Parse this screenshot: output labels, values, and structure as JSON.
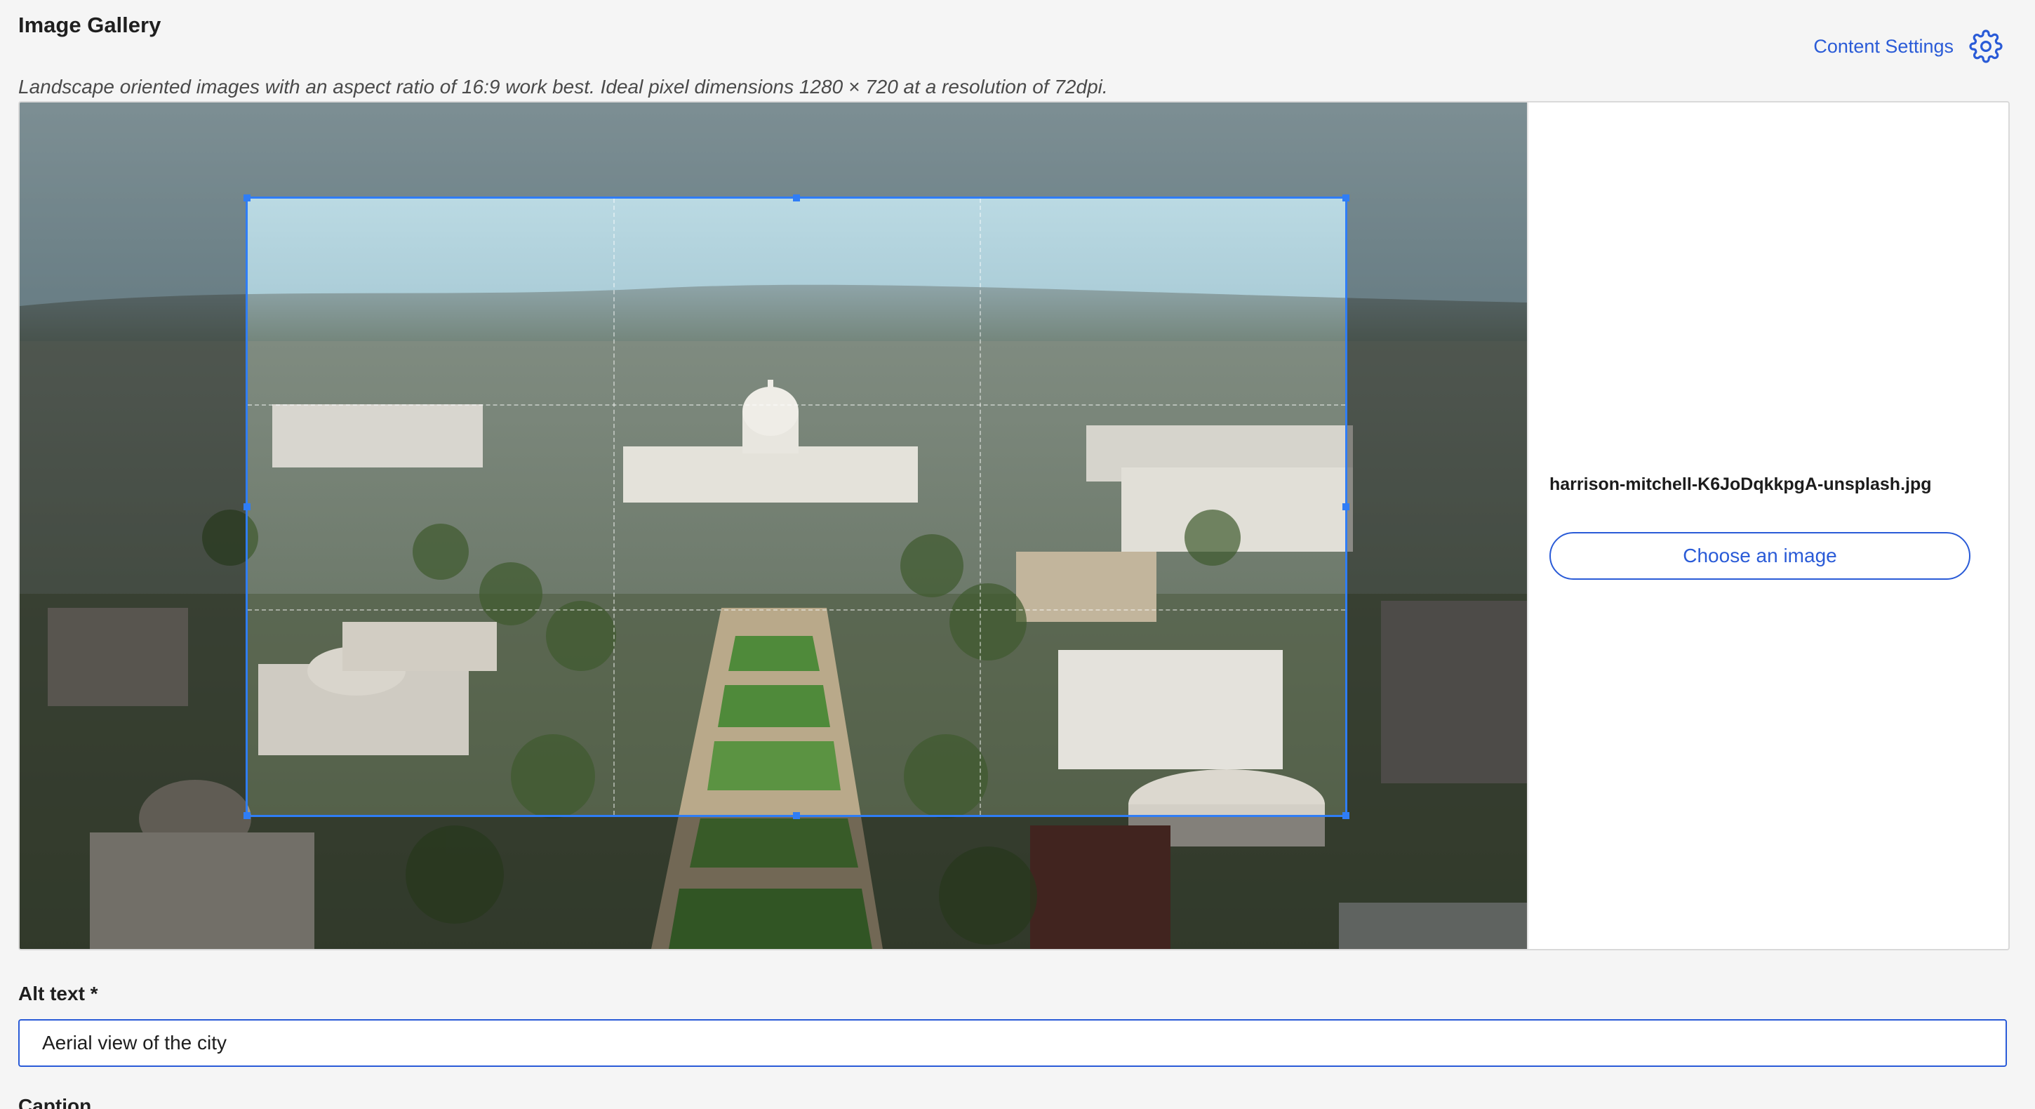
{
  "header": {
    "title": "Image Gallery",
    "settings_label": "Content Settings",
    "settings_icon": "gear-icon"
  },
  "hint": "Landscape oriented images with an aspect ratio of 16:9 work best. Ideal pixel dimensions 1280 × 720 at a resolution of 72dpi.",
  "editor": {
    "image_description_icon": "aerial-city-photo",
    "crop": {
      "aspect_ratio": "16:9"
    },
    "file_name": "harrison-mitchell-K6JoDqkkpgA-unsplash.jpg",
    "choose_button_label": "Choose an image"
  },
  "form": {
    "alt_label": "Alt text *",
    "alt_value": "Aerial view of the city",
    "caption_label": "Caption"
  },
  "colors": {
    "accent": "#2a5bd7",
    "crop_border": "#2f7df6",
    "background": "#f5f5f5"
  }
}
